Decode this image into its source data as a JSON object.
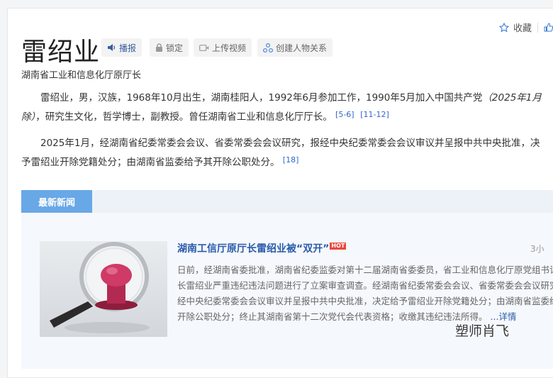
{
  "person": {
    "name": "雷绍业",
    "subtitle": "湖南省工业和信息化厅原厅长"
  },
  "toolbar": {
    "play_label": "播报",
    "lock_label": "锁定",
    "video_label": "上传视频",
    "relation_label": "创建人物关系",
    "favorite_label": "收藏"
  },
  "intro": {
    "p1_line1_a": "雷绍业，男，汉族，1968年10月出生，湖南桂阳人，1992年6月参加工作，1990年5月加入中国共产党",
    "p1_line1_italic": "（2025年1月",
    "p1_line2_italic": "除）",
    "p1_line2_b": "，研究生文化，哲学博士，副教授。曾任湖南省工业和信息化厅厅长。",
    "p1_ref1": "[5-6]",
    "p1_ref2": "[11-12]",
    "p2_line1": "2025年1月，经湖南省纪委常委会会议、省委常委会会议研究，报经中央纪委常委会会议审议并呈报中共中央批准，决",
    "p2_line2": "予雷绍业开除党籍处分；由湖南省监委给予其开除公职处分。",
    "p2_ref": "[18]"
  },
  "news": {
    "tab_label": "最新新闻",
    "item_title": "湖南工信厅原厅长雷绍业被“双开”",
    "hot_badge": "HOT",
    "time": "3小",
    "body_lines": [
      "日前，经湖南省委批准，湖南省纪委监委对第十二届湖南省委委员，省工业和信息化厅原党组书记、",
      "长雷绍业严重违纪违法问题进行了立案审查调查。经湖南省纪委常委会会议、省委常委会会议研究",
      "经中央纪委常委会会议审议并呈报中共中央批准，决定给予雷绍业开除党籍处分；由湖南省监委给予",
      "开除公职处分；终止其湖南省第十二次党代会代表资格；收缴其违纪违法所得。"
    ],
    "more_label": "...详情"
  },
  "watermark": "塑师肖飞",
  "colors": {
    "tab_blue": "#68a8e6",
    "link_blue": "#2a5caa",
    "hot_red": "#e8493d"
  }
}
